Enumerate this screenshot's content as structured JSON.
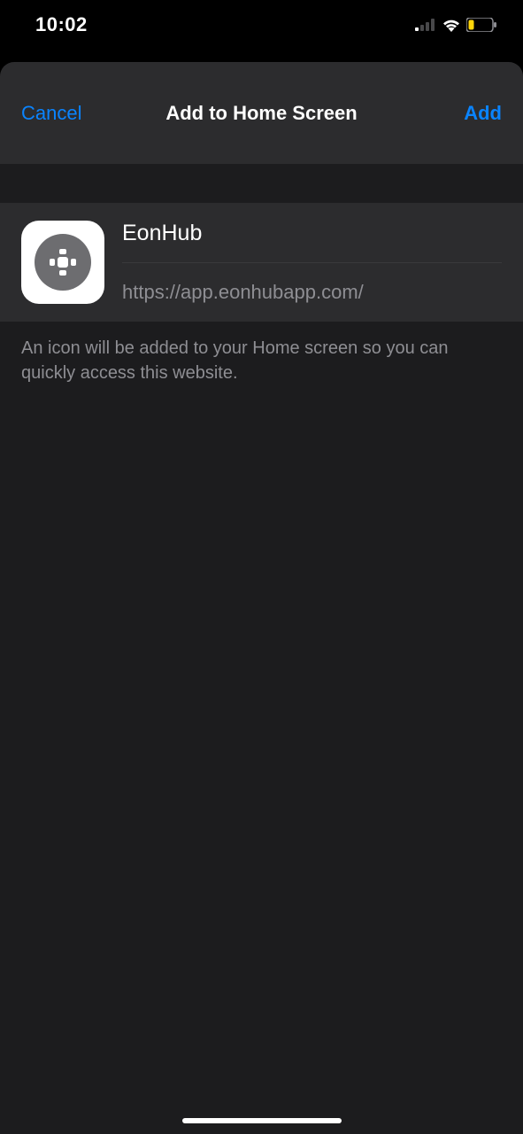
{
  "statusBar": {
    "time": "10:02"
  },
  "modal": {
    "cancelLabel": "Cancel",
    "title": "Add to Home Screen",
    "addLabel": "Add"
  },
  "item": {
    "name": "EonHub",
    "url": "https://app.eonhubapp.com/"
  },
  "description": "An icon will be added to your Home screen so you can quickly access this website."
}
